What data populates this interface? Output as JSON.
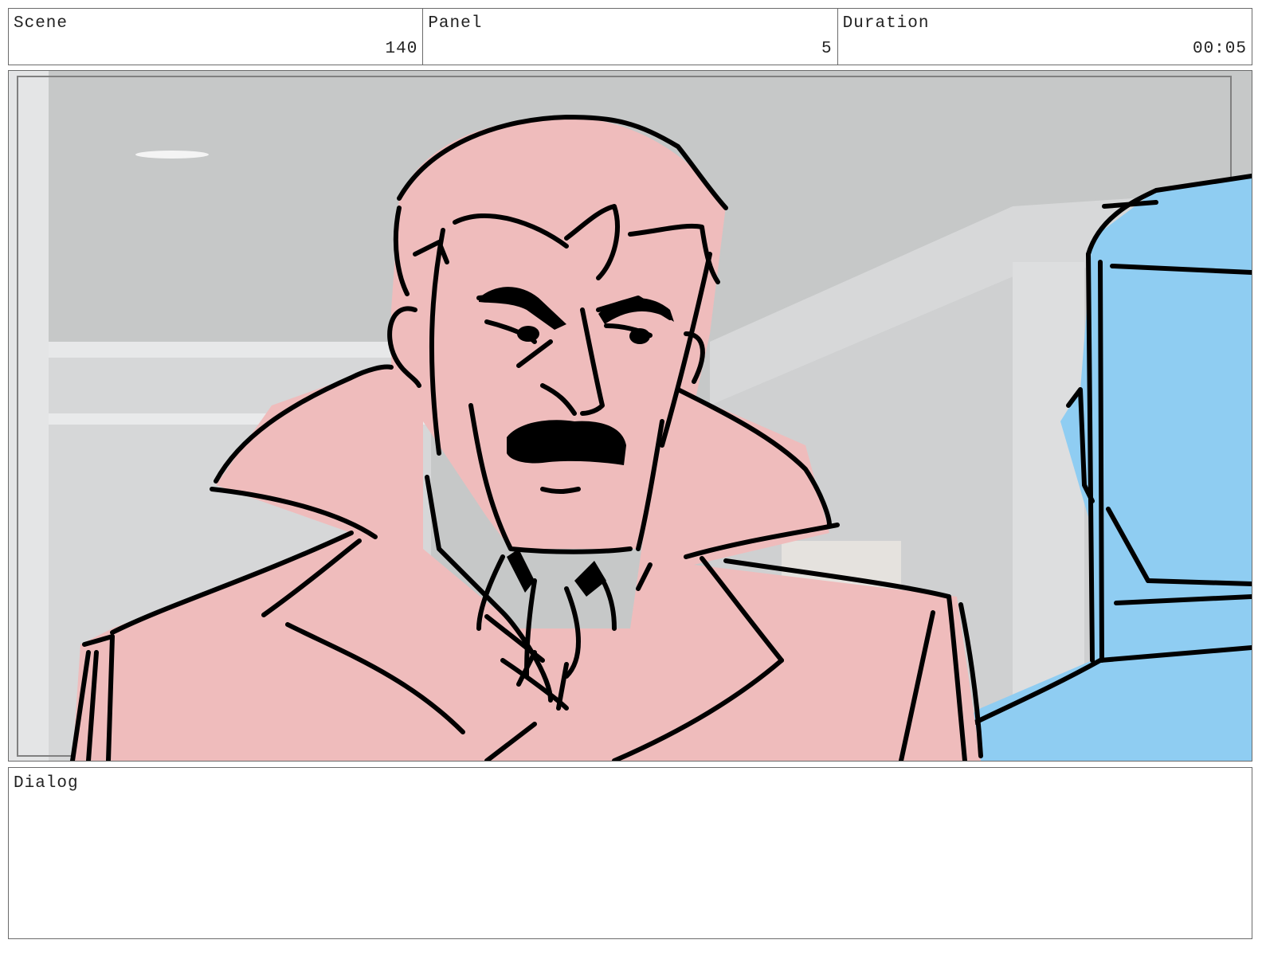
{
  "header": {
    "scene": {
      "label": "Scene",
      "value": "140"
    },
    "panel": {
      "label": "Panel",
      "value": "5"
    },
    "duration": {
      "label": "Duration",
      "value": "00:05"
    }
  },
  "artwork": {
    "description_icon": "storyboard-sketch",
    "colors": {
      "background_wall": "#c9cbcb",
      "character_fill": "#efbcbc",
      "second_character_fill": "#8ecdf1",
      "line": "#000000"
    }
  },
  "dialog": {
    "label": "Dialog",
    "text": ""
  }
}
